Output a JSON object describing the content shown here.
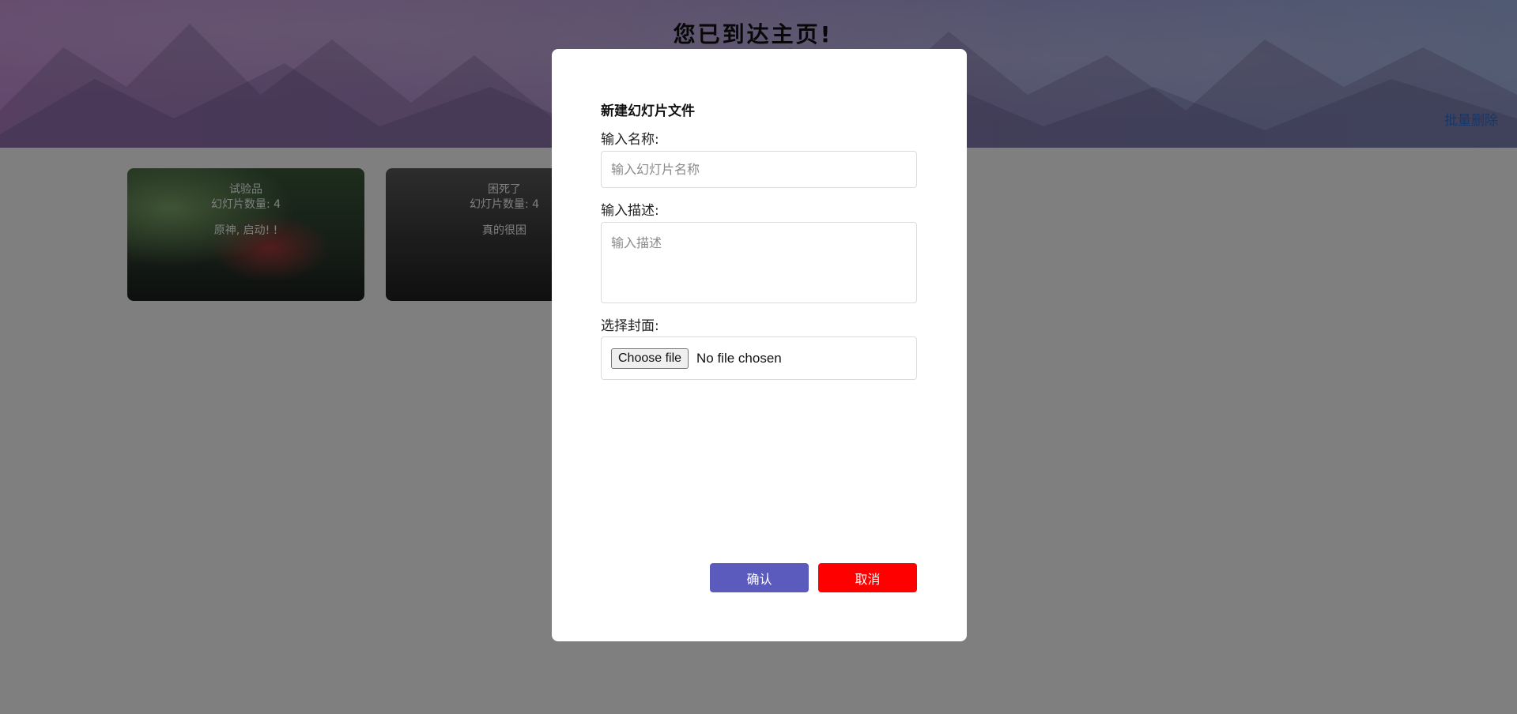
{
  "header": {
    "title": "您已到达主页!",
    "batch_delete_label": "批量删除"
  },
  "cards": [
    {
      "title": "试验品",
      "count_label": "幻灯片数量: 4",
      "description": "原神, 启动! !"
    },
    {
      "title": "困死了",
      "count_label": "幻灯片数量: 4",
      "description": "真的很困"
    }
  ],
  "modal": {
    "title": "新建幻灯片文件",
    "name_label": "输入名称:",
    "name_placeholder": "输入幻灯片名称",
    "name_value": "",
    "desc_label": "输入描述:",
    "desc_placeholder": "输入描述",
    "desc_value": "",
    "cover_label": "选择封面:",
    "file_button_label": "Choose file",
    "file_status": "No file chosen",
    "confirm_label": "确认",
    "cancel_label": "取消"
  },
  "colors": {
    "confirm_button": "#5b5bbd",
    "cancel_button": "#ff0000",
    "link": "#2f6fcf",
    "overlay": "rgba(0,0,0,0.5)"
  }
}
